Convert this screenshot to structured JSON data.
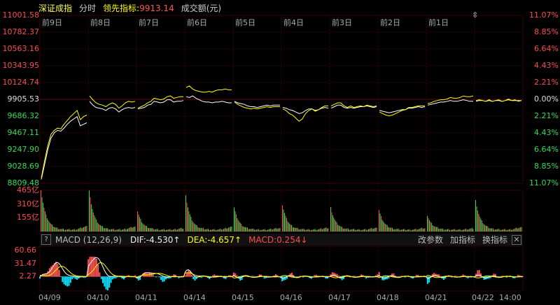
{
  "header": {
    "index_name": "深证成指",
    "mode": "分时",
    "leading_label": "领先指标:",
    "leading_value": "9913.14",
    "volume_label": "成交额(元)"
  },
  "colors": {
    "up": "#ff4d4d",
    "down": "#33dd55",
    "price_line": "#ffffff",
    "leading_line": "#ffff00",
    "dif": "#ffffff",
    "dea": "#ffff00",
    "grid": "#3a0000",
    "macd_pos": "#ff5555",
    "macd_neg": "#00e5ff"
  },
  "price_axis": {
    "left_labels": [
      "11001.58",
      "10782.37",
      "10563.16",
      "10343.95",
      "10124.74",
      "9905.53",
      "9686.32",
      "9467.11",
      "9247.90",
      "9028.69",
      "8809.48"
    ],
    "right_labels": [
      "11.07%",
      "8.85%",
      "6.64%",
      "4.43%",
      "2.21%",
      "0.00%",
      "2.21%",
      "4.43%",
      "6.64%",
      "8.85%",
      "11.07%"
    ]
  },
  "day_labels": [
    "前9日",
    "前8日",
    "前7日",
    "前6日",
    "前5日",
    "前4日",
    "前3日",
    "前2日",
    "前1日"
  ],
  "volume_axis": [
    "465亿",
    "310亿",
    "155亿"
  ],
  "macd": {
    "help": "?",
    "name": "MACD (12,26,9)",
    "dif": "DIF:-4.530↑",
    "dea": "DEA:-4.657↑",
    "value": "MACD:0.254↓",
    "btn_params": "改参数",
    "btn_add": "加指标",
    "btn_switch": "换指标",
    "btn_close": "✕",
    "axis": [
      "60.66",
      "31.47",
      "2.27"
    ]
  },
  "date_labels": [
    "04/09",
    "04/10",
    "04/11",
    "04/14",
    "04/15",
    "04/16",
    "04/17",
    "04/18",
    "04/21",
    "04/22"
  ],
  "time_label": "14:00",
  "chart_data": {
    "type": "line",
    "title": "",
    "ylim": [
      8809.48,
      11001.58
    ],
    "base": 9905.53,
    "categories": [
      "04/09",
      "04/10",
      "04/11",
      "04/14",
      "04/15",
      "04/16",
      "04/17",
      "04/18",
      "04/21",
      "04/22"
    ],
    "series": [
      {
        "name": "",
        "values": [
          [
            8860,
            9050,
            9250,
            9400,
            9470,
            9500,
            9490,
            9530,
            9580,
            9620,
            9650,
            9680,
            9560,
            9580,
            9600
          ],
          [
            9880,
            9830,
            9800,
            9790,
            9780,
            9760,
            9790,
            9800,
            9780,
            9740,
            9770,
            9790,
            9800,
            9790,
            9800
          ],
          [
            9780,
            9790,
            9800,
            9830,
            9840,
            9880,
            9870,
            9860,
            9870,
            9900,
            9900,
            9870,
            9880,
            9880,
            9890
          ],
          [
            9940,
            9930,
            9950,
            9920,
            9900,
            9880,
            9870,
            9870,
            9860,
            9870,
            9870,
            9880,
            9870,
            9860,
            9860
          ],
          [
            9880,
            9860,
            9850,
            9840,
            9820,
            9810,
            9810,
            9800,
            9810,
            9820,
            9830,
            9820,
            9830,
            9830,
            9830
          ],
          [
            9800,
            9790,
            9770,
            9760,
            9740,
            9720,
            9730,
            9760,
            9780,
            9780,
            9760,
            9770,
            9790,
            9800,
            9790
          ],
          [
            9790,
            9810,
            9830,
            9830,
            9800,
            9790,
            9800,
            9790,
            9800,
            9810,
            9810,
            9820,
            9810,
            9800,
            9810
          ],
          [
            9760,
            9750,
            9740,
            9730,
            9740,
            9750,
            9760,
            9770,
            9770,
            9790,
            9790,
            9800,
            9810,
            9800,
            9810
          ],
          [
            9830,
            9840,
            9850,
            9860,
            9870,
            9870,
            9880,
            9890,
            9880,
            9880,
            9890,
            9900,
            9890,
            9880,
            9880
          ],
          [
            9880,
            9890,
            9890,
            9880,
            9890,
            9880,
            9890,
            9890,
            9880,
            9890,
            9900,
            9890,
            9890,
            9890,
            9890
          ]
        ]
      },
      {
        "name": "",
        "values": [
          [
            8880,
            9100,
            9300,
            9450,
            9500,
            9530,
            9520,
            9580,
            9630,
            9680,
            9720,
            9760,
            9640,
            9680,
            9700
          ],
          [
            9950,
            9900,
            9860,
            9840,
            9830,
            9810,
            9840,
            9860,
            9840,
            9790,
            9820,
            9860,
            9880,
            9870,
            9880
          ],
          [
            9790,
            9810,
            9830,
            9860,
            9880,
            9920,
            9910,
            9900,
            9910,
            9940,
            9950,
            9920,
            9930,
            9940,
            9940
          ],
          [
            10060,
            10080,
            10040,
            10020,
            10010,
            10000,
            10000,
            10010,
            10000,
            10020,
            10030,
            10030,
            10040,
            10030,
            10030
          ],
          [
            9870,
            9840,
            9820,
            9800,
            9790,
            9780,
            9790,
            9780,
            9790,
            9800,
            9810,
            9800,
            9810,
            9810,
            9810
          ],
          [
            9780,
            9760,
            9720,
            9700,
            9660,
            9620,
            9650,
            9720,
            9760,
            9780,
            9750,
            9770,
            9800,
            9820,
            9820
          ],
          [
            9820,
            9840,
            9860,
            9860,
            9820,
            9800,
            9820,
            9800,
            9810,
            9820,
            9810,
            9830,
            9820,
            9810,
            9820
          ],
          [
            9740,
            9720,
            9700,
            9690,
            9700,
            9720,
            9740,
            9760,
            9770,
            9800,
            9800,
            9810,
            9820,
            9820,
            9820
          ],
          [
            9850,
            9860,
            9880,
            9890,
            9900,
            9900,
            9910,
            9930,
            9920,
            9920,
            9930,
            9950,
            9940,
            9940,
            9950
          ],
          [
            9890,
            9900,
            9890,
            9880,
            9900,
            9880,
            9890,
            9900,
            9880,
            9890,
            9910,
            9890,
            9900,
            9880,
            9890
          ]
        ]
      }
    ],
    "volume_ylim": [
      0,
      465
    ],
    "volume_peaks": [
      455,
      440,
      210,
      380,
      250,
      280,
      250,
      220,
      160,
      330
    ],
    "macd_ylim": [
      -30,
      70
    ]
  }
}
